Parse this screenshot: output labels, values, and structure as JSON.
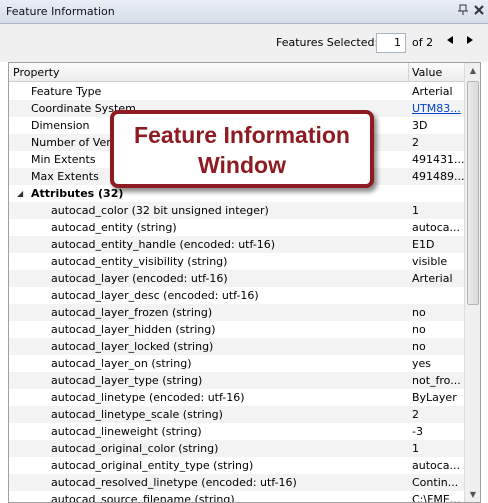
{
  "window": {
    "title": "Feature Information",
    "pin_icon": "pin-icon",
    "close_icon": "close-icon"
  },
  "toolbar": {
    "features_selected_label": "Features Selected:",
    "current_feature": "1",
    "of_total": "of 2",
    "prev_icon": "triangle-left-icon",
    "next_icon": "triangle-right-icon"
  },
  "table": {
    "columns": [
      "Property",
      "Value"
    ],
    "rows": [
      {
        "name": "Feature Type",
        "value": "Arterial"
      },
      {
        "name": "Coordinate System",
        "value": "UTM83...",
        "link": true
      },
      {
        "name": "Dimension",
        "value": "3D"
      },
      {
        "name": "Number of Vertices",
        "value": "2"
      },
      {
        "name": "Min Extents",
        "value": "491431...."
      },
      {
        "name": "Max Extents",
        "value": "491489...."
      },
      {
        "name": "Attributes (32)",
        "value": "",
        "section": true
      },
      {
        "name": "autocad_color (32 bit unsigned integer)",
        "value": "1"
      },
      {
        "name": "autocad_entity (string)",
        "value": "autoca..."
      },
      {
        "name": "autocad_entity_handle (encoded: utf-16)",
        "value": "E1D"
      },
      {
        "name": "autocad_entity_visibility (string)",
        "value": "visible"
      },
      {
        "name": "autocad_layer (encoded: utf-16)",
        "value": "Arterial"
      },
      {
        "name": "autocad_layer_desc (encoded: utf-16)",
        "value": ""
      },
      {
        "name": "autocad_layer_frozen (string)",
        "value": "no"
      },
      {
        "name": "autocad_layer_hidden (string)",
        "value": "no"
      },
      {
        "name": "autocad_layer_locked (string)",
        "value": "no"
      },
      {
        "name": "autocad_layer_on (string)",
        "value": "yes"
      },
      {
        "name": "autocad_layer_type (string)",
        "value": "not_fro..."
      },
      {
        "name": "autocad_linetype (encoded: utf-16)",
        "value": "ByLayer"
      },
      {
        "name": "autocad_linetype_scale (string)",
        "value": "2"
      },
      {
        "name": "autocad_lineweight (string)",
        "value": "-3"
      },
      {
        "name": "autocad_original_color (string)",
        "value": "1"
      },
      {
        "name": "autocad_original_entity_type (string)",
        "value": "autoca..."
      },
      {
        "name": "autocad_resolved_linetype (encoded: utf-16)",
        "value": "Contin..."
      },
      {
        "name": "autocad_source_filename (string)",
        "value": "C:\\FME..."
      }
    ]
  },
  "callout": {
    "line1": "Feature Information",
    "line2": "Window",
    "border_color": "#8e1b22"
  },
  "colors": {
    "link": "#0044cc",
    "row_alt": "#f3f3f3"
  }
}
